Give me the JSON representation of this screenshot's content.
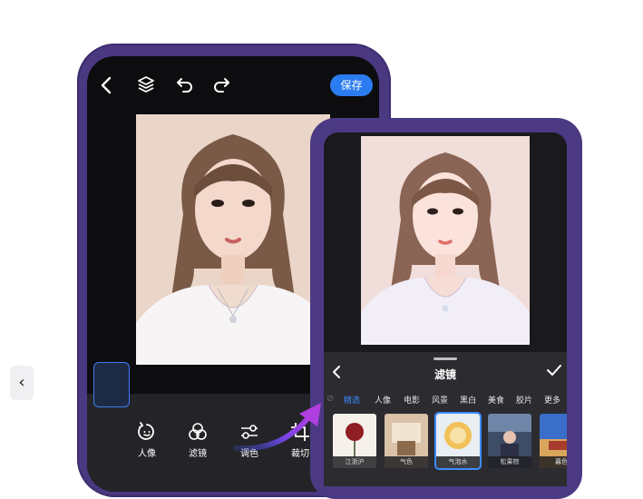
{
  "back_phone": {
    "toolbar": {
      "save_label": "保存"
    },
    "tools": [
      {
        "label": "人像",
        "icon": "portrait-refresh-icon"
      },
      {
        "label": "滤镜",
        "icon": "filter-circles-icon"
      },
      {
        "label": "调色",
        "icon": "adjust-sliders-icon"
      },
      {
        "label": "裁切",
        "icon": "crop-icon"
      }
    ],
    "selected_tool": "滤镜"
  },
  "front_phone": {
    "panel_title": "滤镜",
    "categories": [
      "精选",
      "人像",
      "电影",
      "风景",
      "黑白",
      "美食",
      "胶片",
      "更多"
    ],
    "active_category": "精选",
    "thumbnails": [
      {
        "label": "江浙沪"
      },
      {
        "label": "气色"
      },
      {
        "label": "气泡水"
      },
      {
        "label": "松果棕"
      },
      {
        "label": "暮色"
      }
    ],
    "selected_thumbnail": "气泡水"
  },
  "colors": {
    "accent": "#2b7cf0",
    "phone_frame": "#4a3880",
    "arrow_gradient": [
      "#3b5bf0",
      "#b13fe0"
    ]
  }
}
